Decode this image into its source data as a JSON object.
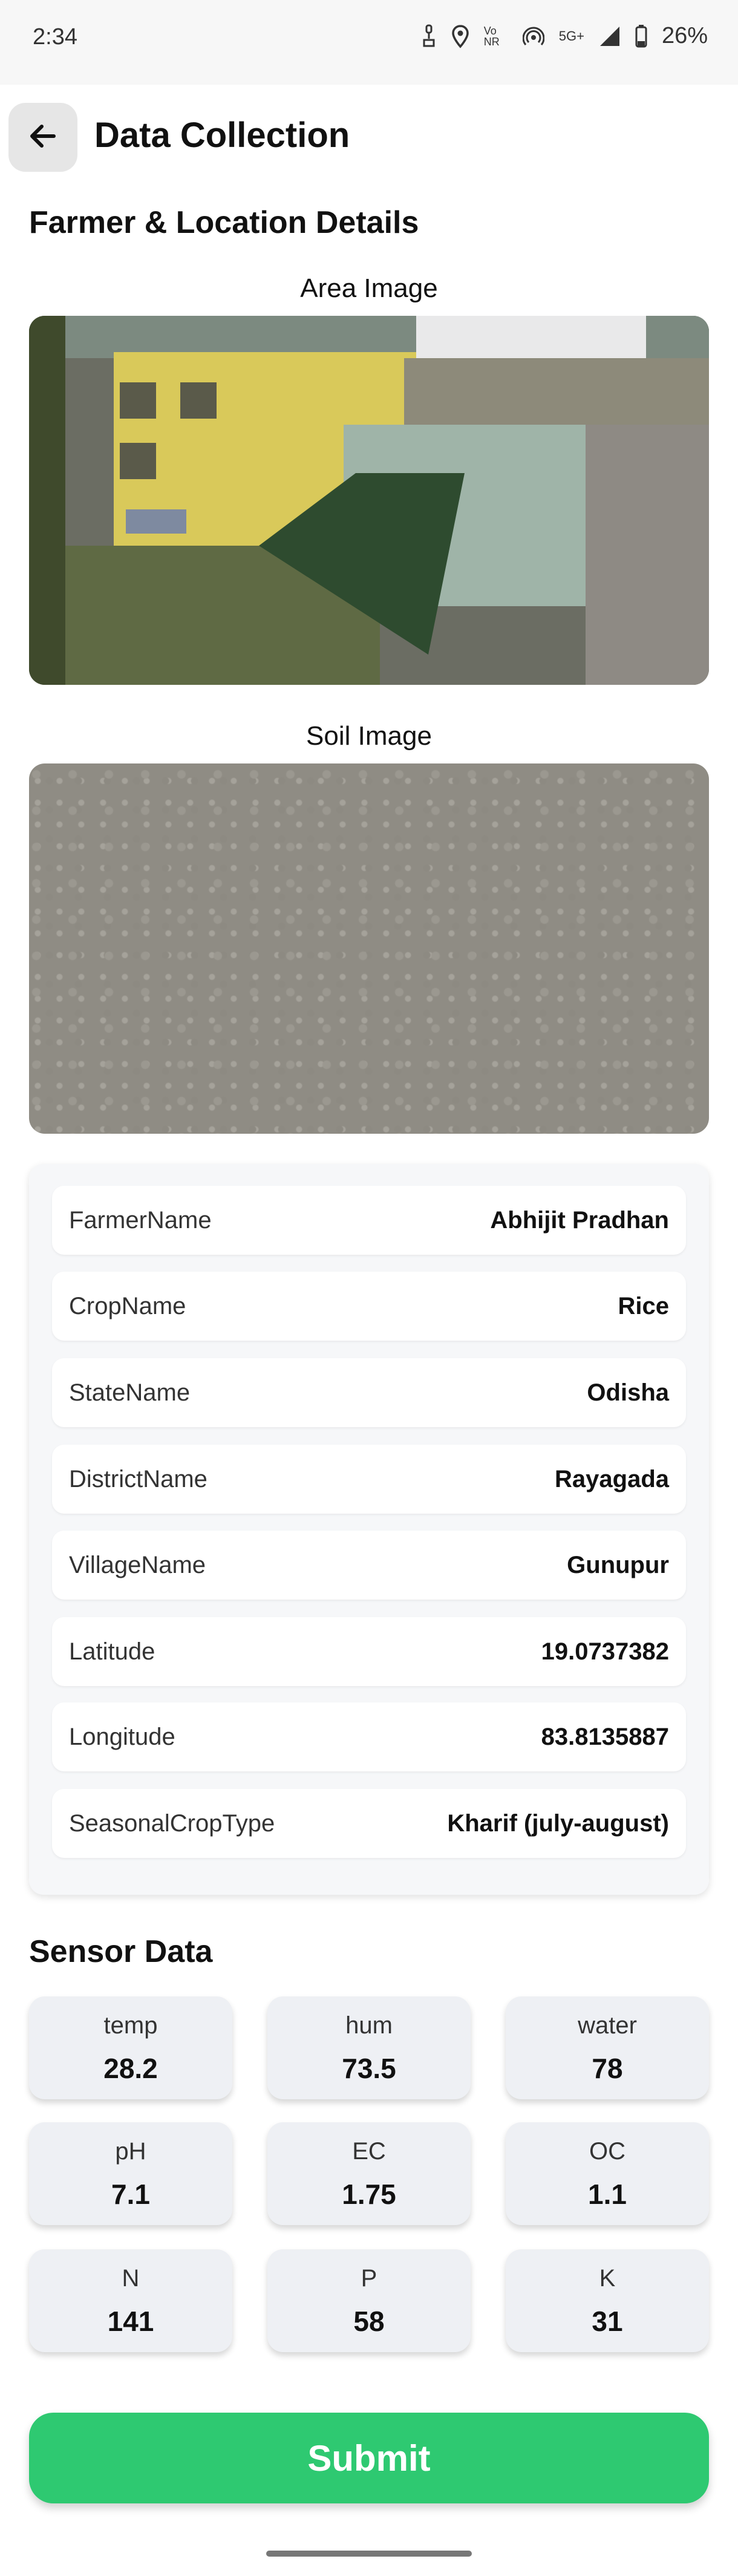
{
  "status_bar": {
    "time": "2:34",
    "network_label": "5G+",
    "vowifi_label": "Vo NR",
    "battery": "26%"
  },
  "app_bar": {
    "title": "Data Collection",
    "back_icon": "arrow-left-icon"
  },
  "farmer_section": {
    "title": "Farmer & Location Details",
    "area_image_label": "Area Image",
    "soil_image_label": "Soil Image",
    "details": [
      {
        "key": "FarmerName",
        "value": "Abhijit Pradhan"
      },
      {
        "key": "CropName",
        "value": "Rice"
      },
      {
        "key": "StateName",
        "value": "Odisha"
      },
      {
        "key": "DistrictName",
        "value": "Rayagada"
      },
      {
        "key": "VillageName",
        "value": "Gunupur"
      },
      {
        "key": "Latitude",
        "value": "19.0737382"
      },
      {
        "key": "Longitude",
        "value": "83.8135887"
      },
      {
        "key": "SeasonalCropType",
        "value": "Kharif (july-august)"
      }
    ]
  },
  "sensor_section": {
    "title": "Sensor Data",
    "tiles": [
      {
        "label": "temp",
        "value": "28.2"
      },
      {
        "label": "hum",
        "value": "73.5"
      },
      {
        "label": "water",
        "value": "78"
      },
      {
        "label": "pH",
        "value": "7.1"
      },
      {
        "label": "EC",
        "value": "1.75"
      },
      {
        "label": "OC",
        "value": "1.1"
      },
      {
        "label": "N",
        "value": "141"
      },
      {
        "label": "P",
        "value": "58"
      },
      {
        "label": "K",
        "value": "31"
      }
    ]
  },
  "submit": {
    "label": "Submit"
  },
  "colors": {
    "accent": "#2ec971",
    "card_bg": "#f6f7f9",
    "tile_bg": "#eef0f4"
  }
}
